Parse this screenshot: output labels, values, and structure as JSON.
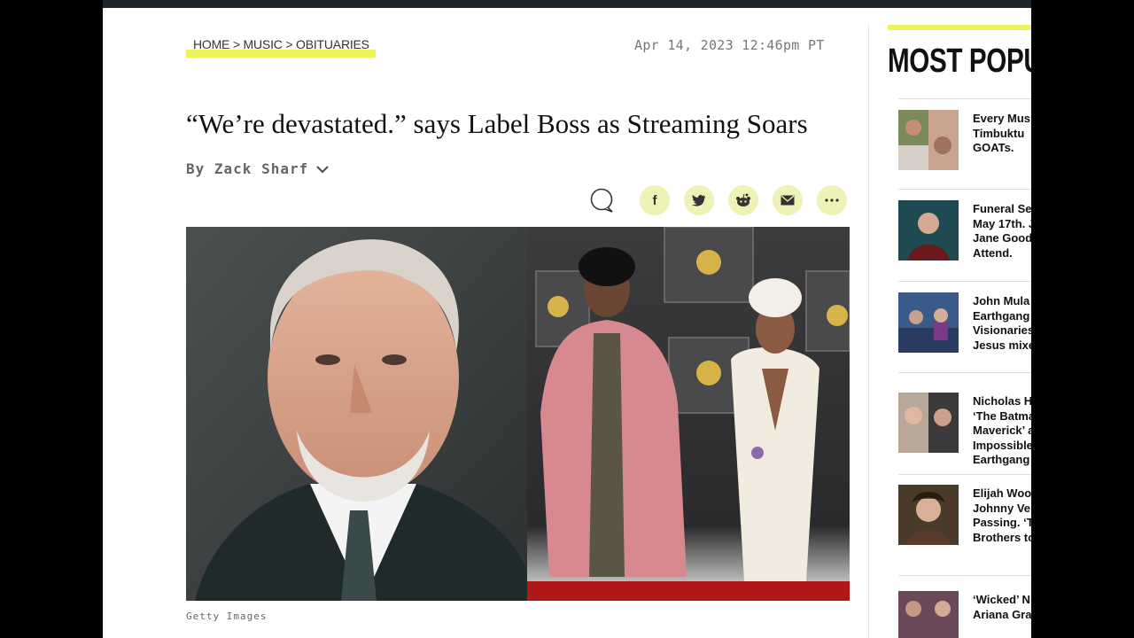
{
  "article": {
    "breadcrumb": "HOME > MUSIC > OBITUARIES",
    "date": "Apr 14, 2023 12:46pm PT",
    "headline": "“We’re devastated.” says Label Boss as Streaming Soars",
    "byline": "By Zack Sharf",
    "image_caption": "Getty Images"
  },
  "share": {
    "icons": [
      "comment-icon",
      "facebook-icon",
      "twitter-icon",
      "reddit-icon",
      "email-icon",
      "more-icon"
    ],
    "labels": {
      "facebook": "f"
    }
  },
  "sidebar": {
    "title": "MOST POPUL",
    "items": [
      {
        "text": "Every Mus\nTimbuktu \nGOATs."
      },
      {
        "text": "Funeral Se\nMay 17th. J\nJane Good\nAttend."
      },
      {
        "text": "John Mula\nEarthgang\nVisionaries\nJesus mixe"
      },
      {
        "text": "Nicholas H\n‘The Batma\nMaverick’ a\nImpossible\nEarthgang"
      },
      {
        "text": "Elijah Woo\nJohnny Ve\nPassing. ‘T\nBrothers to"
      },
      {
        "text": "‘Wicked’ N\nAriana Gra"
      }
    ]
  },
  "colors": {
    "accent": "#eef25a",
    "share_bg": "#eef2b6",
    "frame": "#000000"
  }
}
